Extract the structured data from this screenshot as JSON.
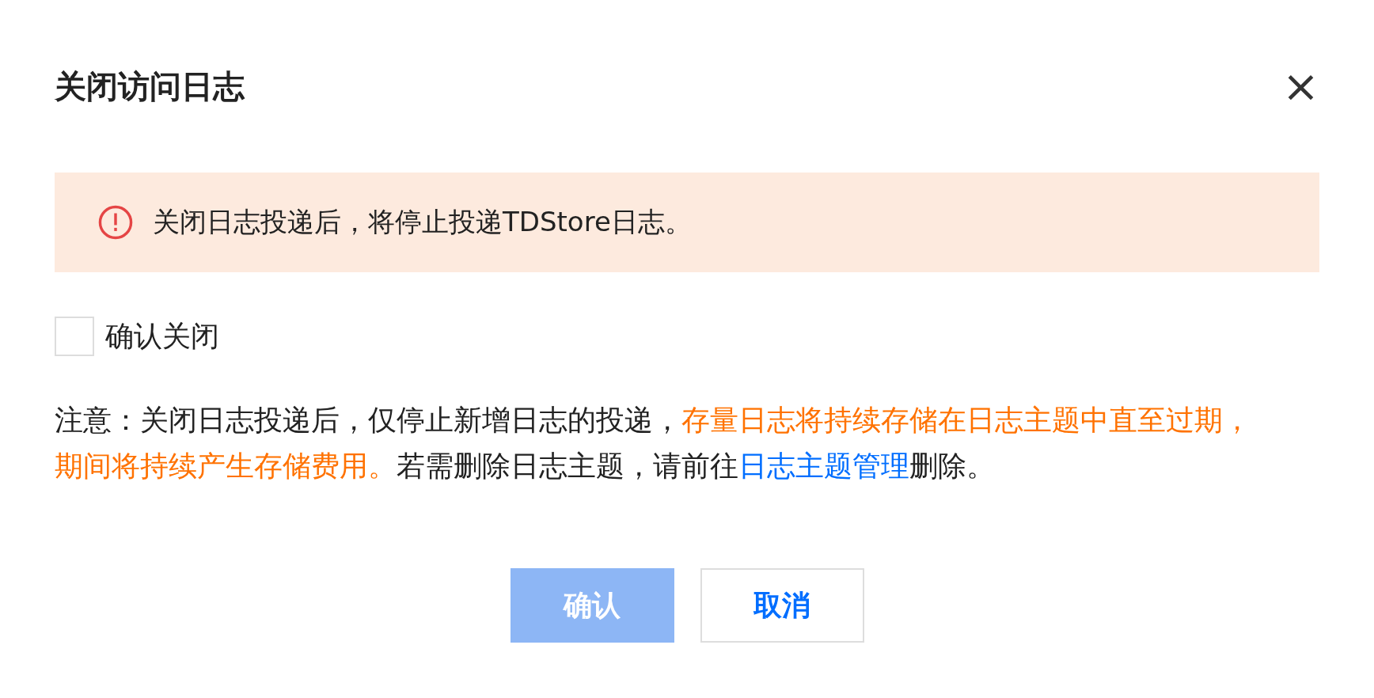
{
  "dialog": {
    "title": "关闭访问日志",
    "close_icon": "×"
  },
  "alert": {
    "text": "关闭日志投递后，将停止投递TDStore日志。"
  },
  "checkbox": {
    "label": "确认关闭",
    "checked": false
  },
  "note": [
    {
      "kind": "normal",
      "text": "注意：关闭日志投递后，仅停止新增日志的投递，"
    },
    {
      "kind": "warning",
      "text": "存量日志将持续存储在日志主题中直至过期，期间将持续产生存储费用。"
    },
    {
      "kind": "normal",
      "text": "若需删除日志主题，请前往"
    },
    {
      "kind": "link",
      "text": "日志主题管理"
    },
    {
      "kind": "normal",
      "text": "删除。"
    }
  ],
  "buttons": [
    {
      "label": "确认",
      "kind": "primary",
      "disabled": true
    },
    {
      "label": "取消",
      "kind": "secondary",
      "disabled": false
    }
  ]
}
